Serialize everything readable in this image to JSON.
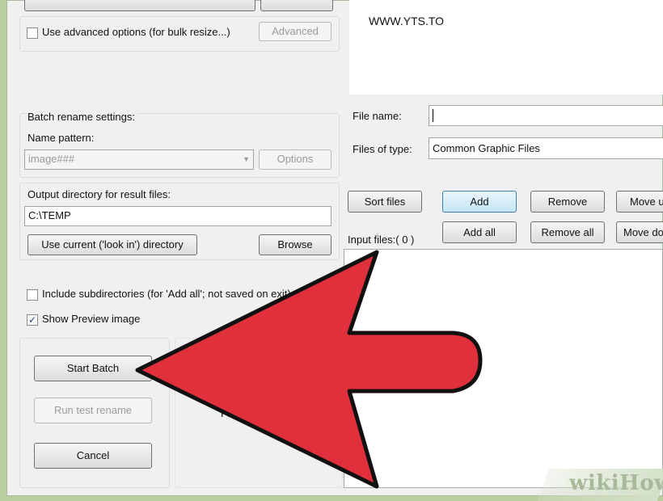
{
  "left": {
    "advanced_checkbox_label": "Use advanced options (for bulk resize...)",
    "advanced_button": "Advanced",
    "batch_rename_title": "Batch rename settings:",
    "name_pattern_label": "Name pattern:",
    "name_pattern_value": "image###",
    "options_button": "Options",
    "output_dir_label": "Output directory for result files:",
    "output_dir_value": "C:\\TEMP",
    "use_current_button": "Use current ('look in') directory",
    "browse_button": "Browse",
    "include_subdirs_label": "Include subdirectories (for 'Add all'; not saved on exit)",
    "include_subdirs_checked": false,
    "show_preview_label": "Show Preview image",
    "show_preview_checked": true,
    "start_batch_button": "Start Batch",
    "run_test_button": "Run test rename",
    "cancel_button": "Cancel",
    "preview_text": "Preview"
  },
  "right": {
    "folder_item": "WWW.YTS.TO",
    "file_name_label": "File name:",
    "file_name_value": "",
    "files_of_type_label": "Files of type:",
    "files_of_type_value": "Common Graphic Files",
    "sort_files_button": "Sort files",
    "add_button": "Add",
    "remove_button": "Remove",
    "move_up_button": "Move up",
    "add_all_button": "Add all",
    "remove_all_button": "Remove all",
    "move_down_button": "Move down",
    "input_files_label": "Input files:( 0 )"
  },
  "overlay": {
    "arrow_color": "#e0303c",
    "watermark": "wikiHow"
  }
}
